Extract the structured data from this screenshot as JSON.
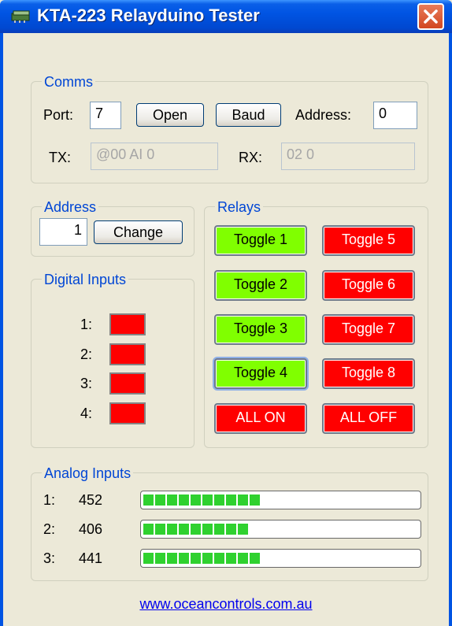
{
  "window": {
    "title": "KTA-223 Relayduino Tester"
  },
  "comms": {
    "legend": "Comms",
    "port_label": "Port:",
    "port_value": "7",
    "open_button": "Open",
    "baud_button": "Baud",
    "address_label": "Address:",
    "address_value": "0",
    "tx_label": "TX:",
    "tx_value": "@00 AI 0",
    "rx_label": "RX:",
    "rx_value": "02 0"
  },
  "address": {
    "legend": "Address",
    "value": "1",
    "change_button": "Change"
  },
  "digital_inputs": {
    "legend": "Digital Inputs",
    "items": [
      {
        "label": "1:",
        "state": "off"
      },
      {
        "label": "2:",
        "state": "off"
      },
      {
        "label": "3:",
        "state": "off"
      },
      {
        "label": "4:",
        "state": "off"
      }
    ]
  },
  "relays": {
    "legend": "Relays",
    "buttons": [
      {
        "label": "Toggle 1",
        "state": "on"
      },
      {
        "label": "Toggle 2",
        "state": "on"
      },
      {
        "label": "Toggle 3",
        "state": "on"
      },
      {
        "label": "Toggle 4",
        "state": "on"
      },
      {
        "label": "Toggle 5",
        "state": "off"
      },
      {
        "label": "Toggle 6",
        "state": "off"
      },
      {
        "label": "Toggle 7",
        "state": "off"
      },
      {
        "label": "Toggle 8",
        "state": "off"
      }
    ],
    "all_on": "ALL ON",
    "all_off": "ALL OFF"
  },
  "analog_inputs": {
    "legend": "Analog Inputs",
    "items": [
      {
        "label": "1:",
        "value": "452",
        "level": 0.44
      },
      {
        "label": "2:",
        "value": "406",
        "level": 0.4
      },
      {
        "label": "3:",
        "value": "441",
        "level": 0.44
      }
    ]
  },
  "footer": {
    "link": "www.oceancontrols.com.au"
  },
  "colors": {
    "on": "#80ff00",
    "off": "#ff0000",
    "bar": "#2fd12f",
    "title": "#0054e3"
  }
}
